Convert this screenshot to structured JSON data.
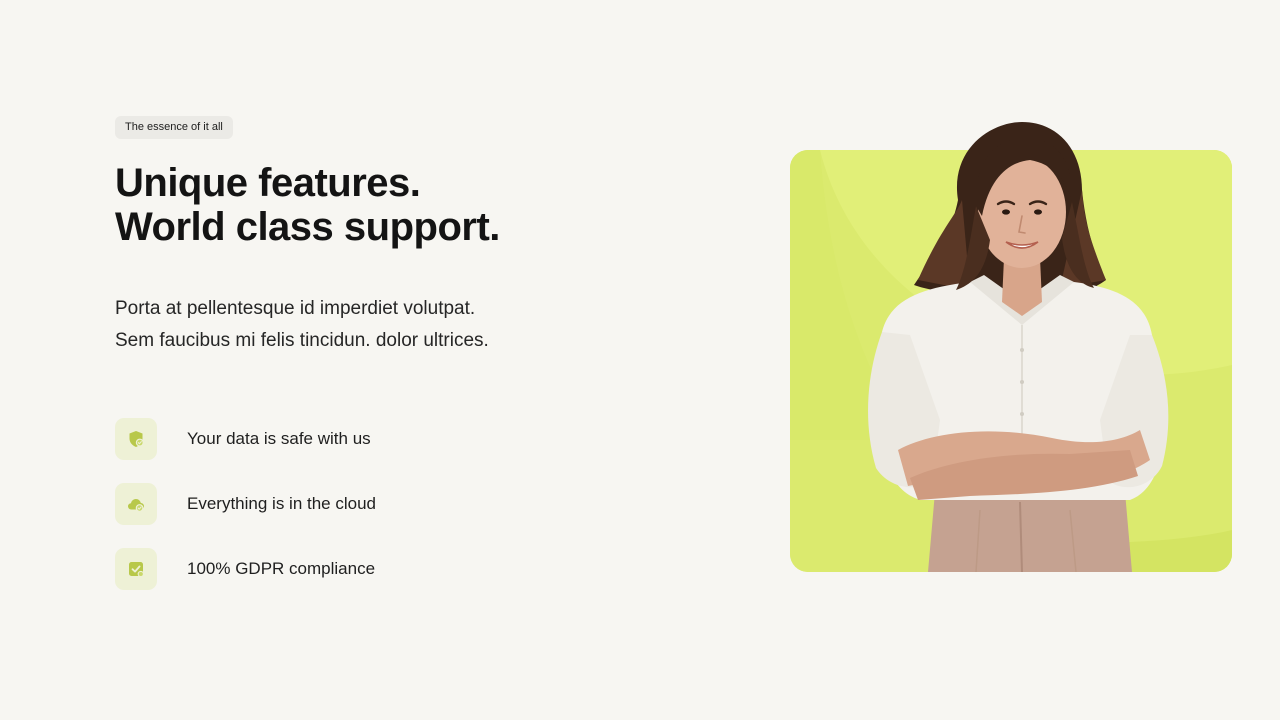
{
  "eyebrow": "The essence of it all",
  "headline": {
    "line1": "Unique features.",
    "line2": "World class support."
  },
  "lede": {
    "line1": "Porta at pellentesque id imperdiet volutpat.",
    "line2": "Sem faucibus mi felis tincidun. dolor ultrices."
  },
  "features": [
    {
      "label": "Your data is safe with us",
      "icon": "shield-icon"
    },
    {
      "label": "Everything is in the cloud",
      "icon": "cloud-icon"
    },
    {
      "label": "100% GDPR compliance",
      "icon": "checkbox-icon"
    }
  ],
  "colors": {
    "background": "#f7f6f2",
    "accent": "#dbea6e",
    "icon_tile": "#eef1d6",
    "icon": "#b8c84a",
    "text": "#141414"
  }
}
